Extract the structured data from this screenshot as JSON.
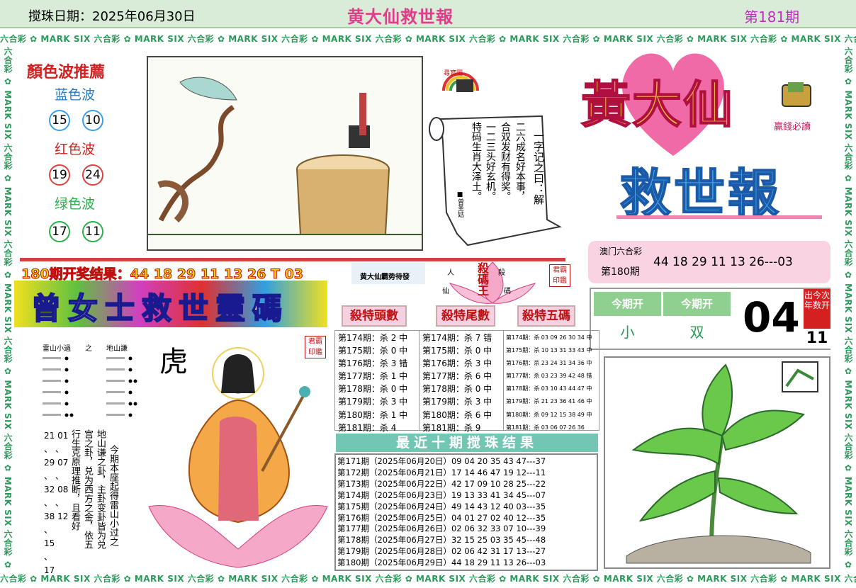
{
  "header": {
    "date_label": "搅珠日期：2025年06月30日",
    "title": "黄大仙救世報",
    "issue": "第181期"
  },
  "border": {
    "text": "六合彩 ✿ MARK SIX 六合彩 ✿ MARK SIX 六合彩 ✿ MARK SIX 六合彩 ✿ MARK SIX 六合彩 ✿ MARK SIX 六合彩 ✿ MARK SIX 六合彩 ✿ MARK SIX 六合彩 ✿ MARK SIX 六合彩 ✿ MARK SIX 六合彩 ✿ MARK SIX 六合彩 ✿ MARK SIX 六合彩 ✿ MARK SIX"
  },
  "color_wave": {
    "title": "顏色波推薦",
    "blue_label": "蓝色波",
    "blue": [
      "15",
      "10"
    ],
    "red_label": "红色波",
    "red": [
      "19",
      "24"
    ],
    "green_label": "绿色波",
    "green": [
      "17",
      "11"
    ]
  },
  "riddle": {
    "badge": "尋寶圖",
    "lines": [
      "一字记之曰：解",
      "二六成名好本事，",
      "合双发财有得奖。",
      "一二三头好玄机。",
      "特码生肖大泽土。"
    ],
    "author": "■曾圣姑"
  },
  "logo": {
    "main": "黃大仙",
    "sub": "救世報",
    "slogan": "贏錢必讀"
  },
  "macau": {
    "label": "澳门六合彩",
    "issue": "第180期",
    "numbers": "44  18  29  11  13  26---03"
  },
  "this_issue": {
    "label_1": "今期开",
    "label_2": "今期开",
    "value_1": "小",
    "value_2": "双",
    "big_number": "04",
    "side_text": "出今次年数开",
    "side_number": "11"
  },
  "result_180": "180期开奖结果：44 18 29 11 13 26 T 03",
  "banner": "曾女士救世靈碼",
  "lotus": {
    "tag": "黄大仙霸势待發",
    "king": "殺碼王",
    "words": [
      "人",
      "殺",
      "仙",
      "碼"
    ],
    "seal": "君霸印鑑"
  },
  "kill_headers": [
    "殺特頭數",
    "殺特尾數",
    "殺特五碼"
  ],
  "kill_head": [
    "第174期：杀 2 中",
    "第175期：杀 0 中",
    "第176期：杀 3 错",
    "第177期：杀 1 中",
    "第178期：杀 0 中",
    "第179期：杀 3 中",
    "第180期：杀 1 中",
    "第181期：杀 4"
  ],
  "kill_tail": [
    "第174期：杀 7 错",
    "第175期：杀 0 中",
    "第176期：杀 3 中",
    "第177期：杀 6 中",
    "第178期：杀 0 中",
    "第179期：杀 3 中",
    "第180期：杀 6 中",
    "第181期：杀 9"
  ],
  "kill_five": [
    "第174期：杀 03 09 26 30 34 中",
    "第175期：杀 10 13 31 33 43 中",
    "第176期：杀 23 24 31 34 36 中",
    "第177期：杀 03 23 39 42 48 错",
    "第178期：杀 03 10 43 44 47 中",
    "第179期：杀 21 23 36 41 46 中",
    "第180期：杀 09 12 15 38 49 中",
    "第181期：杀 03 06 07 26 36"
  ],
  "recent_title": "最近十期搅珠结果",
  "recent": [
    "第171期（2025年06月20日）09 04 20 35 43 47---37",
    "第172期（2025年06月21日）17 14 46 47 19 12---11",
    "第173期（2025年06月22日）42 17 09 10 28 25---22",
    "第174期（2025年06月23日）19 13 33 41 34 45---07",
    "第175期（2025年06月24日）49 14 43 12 40 03---35",
    "第176期（2025年06月25日）04 01 27 02 40 12---35",
    "第177期（2025年06月26日）02 06 32 33 07 10---39",
    "第178期（2025年06月27日）32 15 25 03 35 45---48",
    "第179期（2025年06月28日）02 06 42 31 17 13---27",
    "第180期（2025年06月29日）44 18 29 11 13 26---03"
  ],
  "gua": {
    "title": "雷山小過　　之　　地山謙",
    "animal": "虎",
    "seal": "君霸印鑑",
    "text_1": "今期本座起得雷山小过之",
    "text_2": "地山谦之卦，主卦变卦皆为兑",
    "text_3": "宫之卦，兑为西方之金，依五",
    "text_4": "行生克原理推断，且看好",
    "numbers": [
      "21 01",
      "、  、",
      "29 07",
      "、  、",
      "32 08",
      "、  、",
      "38 12",
      "    、",
      "    15",
      "    、",
      "    17"
    ]
  }
}
